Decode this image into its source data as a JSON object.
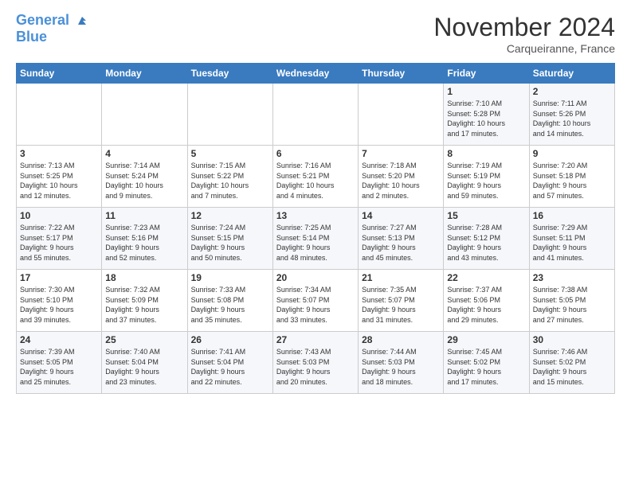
{
  "header": {
    "logo_line1": "General",
    "logo_line2": "Blue",
    "month": "November 2024",
    "location": "Carqueiranne, France"
  },
  "weekdays": [
    "Sunday",
    "Monday",
    "Tuesday",
    "Wednesday",
    "Thursday",
    "Friday",
    "Saturday"
  ],
  "weeks": [
    [
      {
        "day": "",
        "info": ""
      },
      {
        "day": "",
        "info": ""
      },
      {
        "day": "",
        "info": ""
      },
      {
        "day": "",
        "info": ""
      },
      {
        "day": "",
        "info": ""
      },
      {
        "day": "1",
        "info": "Sunrise: 7:10 AM\nSunset: 5:28 PM\nDaylight: 10 hours\nand 17 minutes."
      },
      {
        "day": "2",
        "info": "Sunrise: 7:11 AM\nSunset: 5:26 PM\nDaylight: 10 hours\nand 14 minutes."
      }
    ],
    [
      {
        "day": "3",
        "info": "Sunrise: 7:13 AM\nSunset: 5:25 PM\nDaylight: 10 hours\nand 12 minutes."
      },
      {
        "day": "4",
        "info": "Sunrise: 7:14 AM\nSunset: 5:24 PM\nDaylight: 10 hours\nand 9 minutes."
      },
      {
        "day": "5",
        "info": "Sunrise: 7:15 AM\nSunset: 5:22 PM\nDaylight: 10 hours\nand 7 minutes."
      },
      {
        "day": "6",
        "info": "Sunrise: 7:16 AM\nSunset: 5:21 PM\nDaylight: 10 hours\nand 4 minutes."
      },
      {
        "day": "7",
        "info": "Sunrise: 7:18 AM\nSunset: 5:20 PM\nDaylight: 10 hours\nand 2 minutes."
      },
      {
        "day": "8",
        "info": "Sunrise: 7:19 AM\nSunset: 5:19 PM\nDaylight: 9 hours\nand 59 minutes."
      },
      {
        "day": "9",
        "info": "Sunrise: 7:20 AM\nSunset: 5:18 PM\nDaylight: 9 hours\nand 57 minutes."
      }
    ],
    [
      {
        "day": "10",
        "info": "Sunrise: 7:22 AM\nSunset: 5:17 PM\nDaylight: 9 hours\nand 55 minutes."
      },
      {
        "day": "11",
        "info": "Sunrise: 7:23 AM\nSunset: 5:16 PM\nDaylight: 9 hours\nand 52 minutes."
      },
      {
        "day": "12",
        "info": "Sunrise: 7:24 AM\nSunset: 5:15 PM\nDaylight: 9 hours\nand 50 minutes."
      },
      {
        "day": "13",
        "info": "Sunrise: 7:25 AM\nSunset: 5:14 PM\nDaylight: 9 hours\nand 48 minutes."
      },
      {
        "day": "14",
        "info": "Sunrise: 7:27 AM\nSunset: 5:13 PM\nDaylight: 9 hours\nand 45 minutes."
      },
      {
        "day": "15",
        "info": "Sunrise: 7:28 AM\nSunset: 5:12 PM\nDaylight: 9 hours\nand 43 minutes."
      },
      {
        "day": "16",
        "info": "Sunrise: 7:29 AM\nSunset: 5:11 PM\nDaylight: 9 hours\nand 41 minutes."
      }
    ],
    [
      {
        "day": "17",
        "info": "Sunrise: 7:30 AM\nSunset: 5:10 PM\nDaylight: 9 hours\nand 39 minutes."
      },
      {
        "day": "18",
        "info": "Sunrise: 7:32 AM\nSunset: 5:09 PM\nDaylight: 9 hours\nand 37 minutes."
      },
      {
        "day": "19",
        "info": "Sunrise: 7:33 AM\nSunset: 5:08 PM\nDaylight: 9 hours\nand 35 minutes."
      },
      {
        "day": "20",
        "info": "Sunrise: 7:34 AM\nSunset: 5:07 PM\nDaylight: 9 hours\nand 33 minutes."
      },
      {
        "day": "21",
        "info": "Sunrise: 7:35 AM\nSunset: 5:07 PM\nDaylight: 9 hours\nand 31 minutes."
      },
      {
        "day": "22",
        "info": "Sunrise: 7:37 AM\nSunset: 5:06 PM\nDaylight: 9 hours\nand 29 minutes."
      },
      {
        "day": "23",
        "info": "Sunrise: 7:38 AM\nSunset: 5:05 PM\nDaylight: 9 hours\nand 27 minutes."
      }
    ],
    [
      {
        "day": "24",
        "info": "Sunrise: 7:39 AM\nSunset: 5:05 PM\nDaylight: 9 hours\nand 25 minutes."
      },
      {
        "day": "25",
        "info": "Sunrise: 7:40 AM\nSunset: 5:04 PM\nDaylight: 9 hours\nand 23 minutes."
      },
      {
        "day": "26",
        "info": "Sunrise: 7:41 AM\nSunset: 5:04 PM\nDaylight: 9 hours\nand 22 minutes."
      },
      {
        "day": "27",
        "info": "Sunrise: 7:43 AM\nSunset: 5:03 PM\nDaylight: 9 hours\nand 20 minutes."
      },
      {
        "day": "28",
        "info": "Sunrise: 7:44 AM\nSunset: 5:03 PM\nDaylight: 9 hours\nand 18 minutes."
      },
      {
        "day": "29",
        "info": "Sunrise: 7:45 AM\nSunset: 5:02 PM\nDaylight: 9 hours\nand 17 minutes."
      },
      {
        "day": "30",
        "info": "Sunrise: 7:46 AM\nSunset: 5:02 PM\nDaylight: 9 hours\nand 15 minutes."
      }
    ]
  ]
}
